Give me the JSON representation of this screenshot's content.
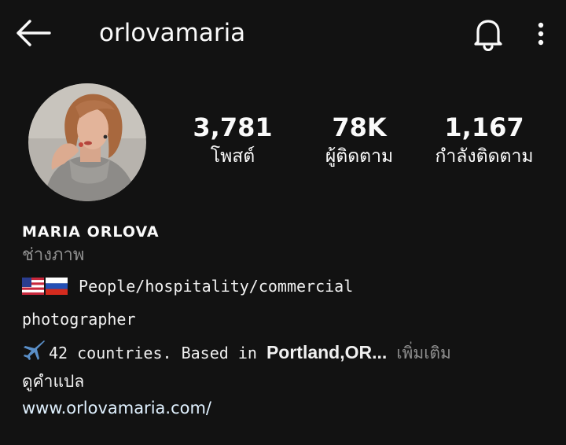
{
  "header": {
    "username": "orlovamaria",
    "back_icon": "arrow-left-icon",
    "bell_icon": "bell-icon",
    "more_icon": "more-vertical-icon"
  },
  "profile": {
    "stats": {
      "posts": {
        "value": "3,781",
        "label": "โพสต์"
      },
      "followers": {
        "value": "78K",
        "label": "ผู้ติดตาม"
      },
      "following": {
        "value": "1,167",
        "label": "กำลังติดตาม"
      }
    },
    "full_name": "MARIA ORLOVA",
    "category": "ช่างภาพ",
    "bio": {
      "line1": "People/hospitality/commercial",
      "line2": "photographer",
      "line3_prefix": "42 countries. Based in ",
      "line3_location": "Portland,OR",
      "line3_ellipsis": "...",
      "more": "เพิ่มเติม",
      "flags": [
        "us-flag-icon",
        "russia-flag-icon"
      ],
      "plane_icon": "airplane-icon"
    },
    "see_translation": "ดูคำแปล",
    "website": "www.orlovamaria.com/"
  },
  "colors": {
    "background": "#121212",
    "text": "#fafafa",
    "secondary": "#8e8e8e",
    "link": "#e0f1ff"
  }
}
